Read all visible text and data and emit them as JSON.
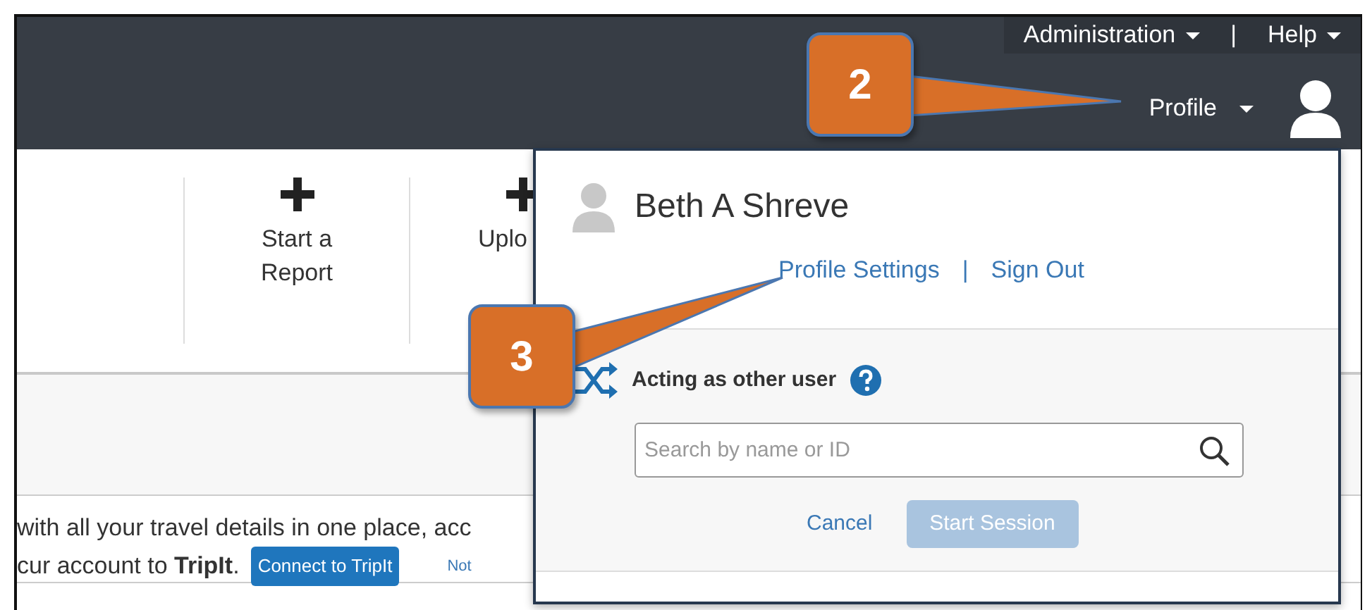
{
  "top_menu": {
    "items": [
      {
        "label": "Administration"
      },
      {
        "label": "Help"
      }
    ],
    "separator": "|"
  },
  "profile_menu": {
    "label": "Profile",
    "expanded": true
  },
  "tiles": [
    {
      "label": "Start a\nReport"
    },
    {
      "label": "Uplo"
    }
  ],
  "tripit_banner": {
    "line_1": "with all your travel details in one place, acc",
    "line_2": "cur account to **TripIt**.",
    "button": "Connect to TripIt",
    "link": "Not"
  },
  "profile_panel": {
    "name": "Beth A Shreve",
    "links": [
      "Profile Settings",
      "Sign Out"
    ],
    "link_separator": "|",
    "acting": {
      "title": "Acting as other user",
      "search": {
        "placeholder": "Search by name or ID"
      },
      "cancel": "Cancel",
      "start": {
        "label": "Start Session",
        "disabled": true
      }
    }
  },
  "callouts": [
    {
      "number": "2"
    },
    {
      "number": "3"
    }
  ]
}
